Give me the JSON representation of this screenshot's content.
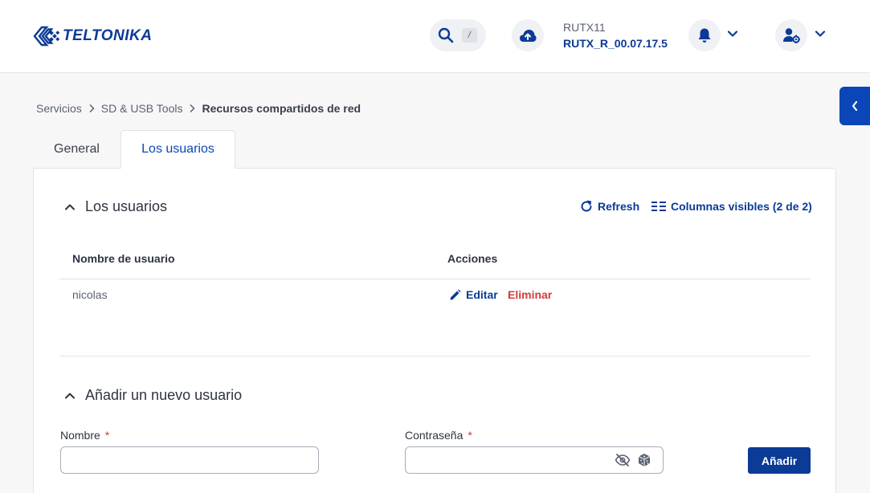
{
  "header": {
    "logo_text": "TELTONIKA",
    "search_shortcut": "/",
    "device_model": "RUTX11",
    "firmware_version": "RUTX_R_00.07.17.5",
    "icons": [
      "search-icon",
      "upload-cloud-icon",
      "bell-icon",
      "user-settings-icon",
      "chevron-down-icon"
    ]
  },
  "breadcrumb": {
    "items": [
      "Servicios",
      "SD & USB Tools"
    ],
    "current": "Recursos compartidos de red"
  },
  "tabs": [
    {
      "label": "General",
      "active": false
    },
    {
      "label": "Los usuarios",
      "active": true
    }
  ],
  "users_section": {
    "title": "Los usuarios",
    "refresh_label": "Refresh",
    "columns_label": "Columnas visibles (2 de 2)",
    "columns": [
      "Nombre de usuario",
      "Acciones"
    ],
    "rows": [
      {
        "username": "nicolas",
        "edit_label": "Editar",
        "delete_label": "Eliminar"
      }
    ]
  },
  "add_section": {
    "title": "Añadir un nuevo usuario",
    "name_label": "Nombre",
    "password_label": "Contraseña",
    "required_mark": "*",
    "name_value": "",
    "password_value": "",
    "add_button_label": "Añadir"
  },
  "colors": {
    "brand": "#0b3a97",
    "accent": "#0b46b8",
    "danger": "#d23b3b"
  }
}
